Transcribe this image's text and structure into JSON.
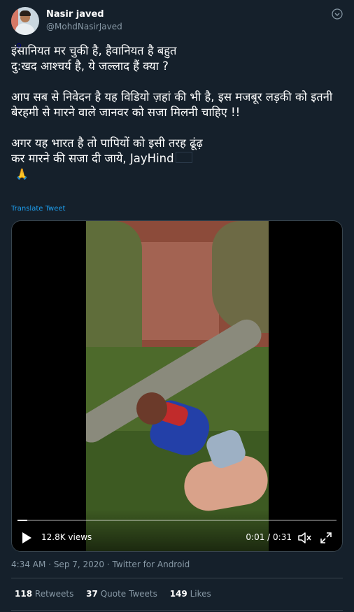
{
  "author": {
    "name": "Nasir javed",
    "handle": "@MohdNasirJaved"
  },
  "tweet": {
    "paragraphs": [
      "इंसानियत मर चुकी है, हैवानियत है बहुत\nदु:खद आश्चर्य है, ये जल्लाद हैं क्या ?",
      "आप सब से निवेदन है यह विडियो ज़हां की भी है, इस मजबूर लड़की को इतनी बेरहमी से मारने वाले जानवर को सजा मिलनी चाहिए !!",
      "अगर यह भारत है तो पापियों को इसी तरह ढूंढ़\nकर मारने की सजा दी जाये, JayHind"
    ],
    "flag_icon": "india-flag-icon",
    "pray_emoji": "🙏",
    "translate_label": "Translate Tweet"
  },
  "video": {
    "views": "12.8K views",
    "time": "0:01 / 0:31",
    "progress": 0.03
  },
  "meta": {
    "time": "4:34 AM",
    "date": "Sep 7, 2020",
    "source": "Twitter for Android",
    "separator": "·"
  },
  "stats": {
    "retweets_count": "118",
    "retweets_label": "Retweets",
    "quote_count": "37",
    "quote_label": "Quote Tweets",
    "likes_count": "149",
    "likes_label": "Likes"
  },
  "colors": {
    "background": "#15202b",
    "accent": "#1da1f2",
    "muted": "#8899a6",
    "border": "#38444d"
  }
}
